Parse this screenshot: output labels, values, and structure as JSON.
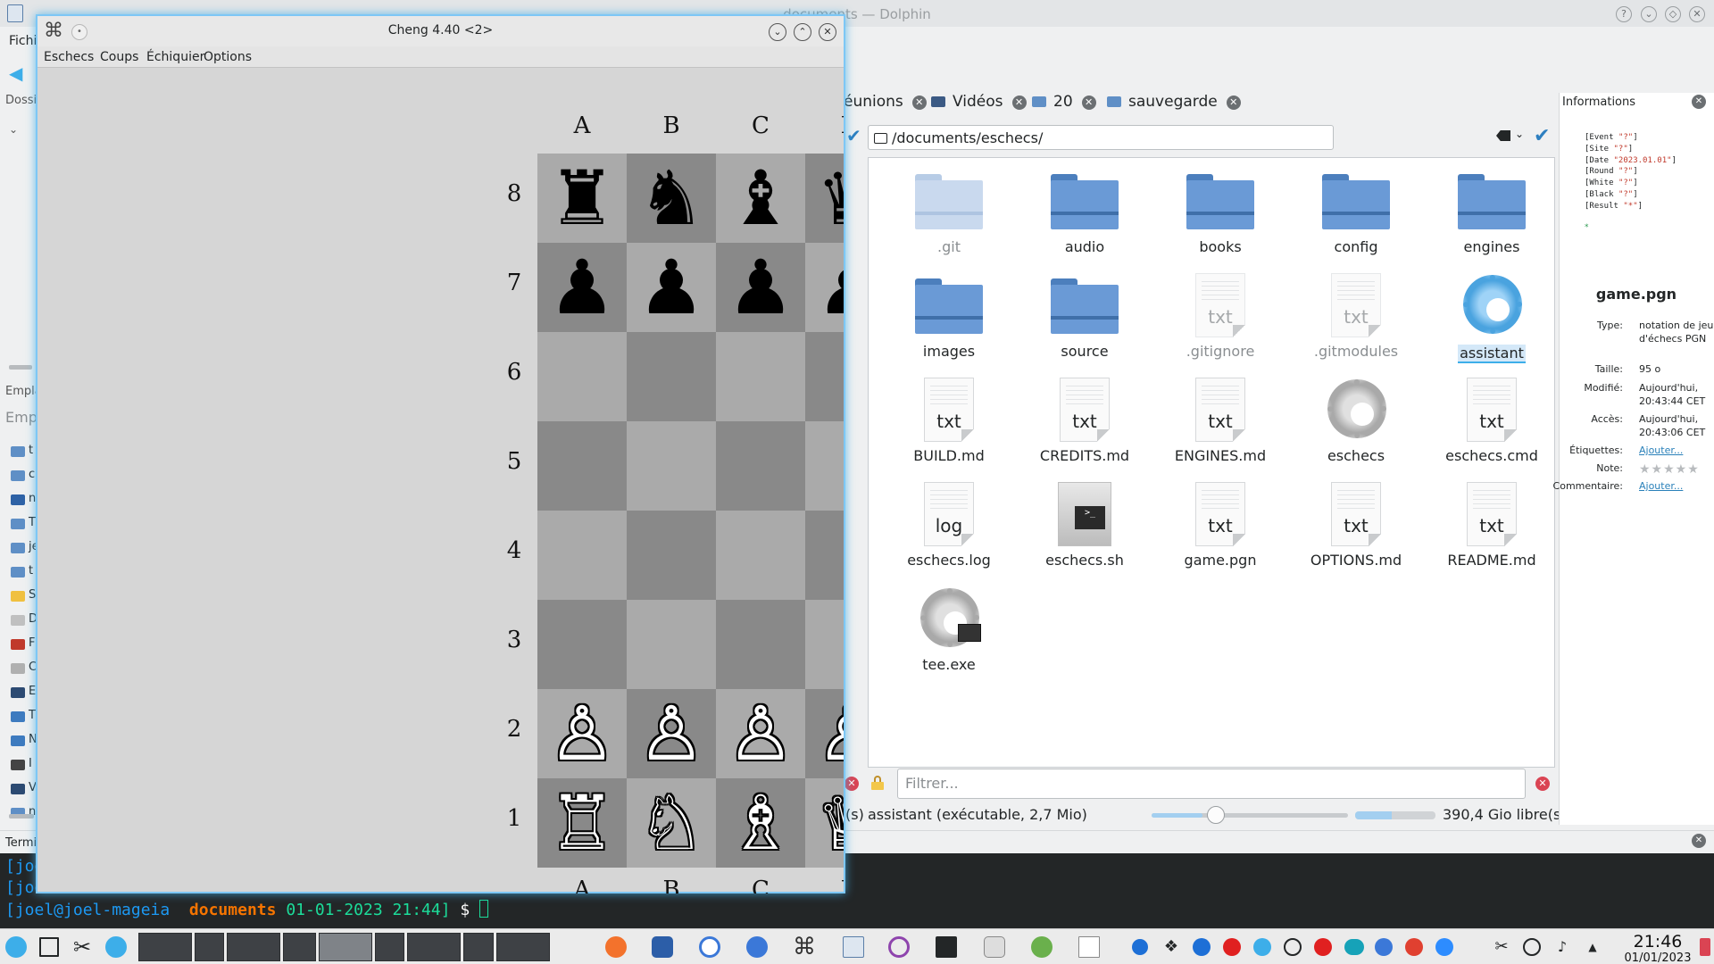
{
  "dolphin": {
    "title": "documents — Dolphin",
    "menu_partial": "Fichi",
    "sidebar": {
      "dossiers_label": "Dossi",
      "places_label": "Empla",
      "places_search": "Emp",
      "items": [
        {
          "label": "t",
          "color": "#5f8fc6"
        },
        {
          "label": "c",
          "color": "#5f8fc6"
        },
        {
          "label": "n",
          "color": "#2e62a6"
        },
        {
          "label": "T",
          "color": "#5f8fc6"
        },
        {
          "label": "je",
          "color": "#5f8fc6"
        },
        {
          "label": "t",
          "color": "#5f8fc6"
        },
        {
          "label": "S",
          "color": "#f0c040"
        },
        {
          "label": "D",
          "color": "#c0c0c0"
        },
        {
          "label": "F",
          "color": "#c0392b"
        },
        {
          "label": "C",
          "color": "#b0b0b0"
        },
        {
          "label": "E",
          "color": "#2c4a72"
        },
        {
          "label": "T",
          "color": "#3e7bbf"
        },
        {
          "label": "N",
          "color": "#3e7bbf"
        },
        {
          "label": "I",
          "color": "#444"
        },
        {
          "label": "V",
          "color": "#2c4a72"
        },
        {
          "label": "n",
          "color": "#5f8fc6"
        }
      ]
    },
    "tabs": [
      {
        "label": "éunions"
      },
      {
        "label": "Vidéos"
      },
      {
        "label": "20"
      },
      {
        "label": "sauvegarde"
      }
    ],
    "location": "/documents/eschecs/",
    "files": [
      {
        "name": ".git",
        "kind": "folder-dim"
      },
      {
        "name": "audio",
        "kind": "folder"
      },
      {
        "name": "books",
        "kind": "folder"
      },
      {
        "name": "config",
        "kind": "folder"
      },
      {
        "name": "engines",
        "kind": "folder"
      },
      {
        "name": "images",
        "kind": "folder"
      },
      {
        "name": "source",
        "kind": "folder"
      },
      {
        "name": ".gitignore",
        "kind": "text-dim",
        "ext": "txt"
      },
      {
        "name": ".gitmodules",
        "kind": "text-dim",
        "ext": "txt"
      },
      {
        "name": "assistant",
        "kind": "gear-blue"
      },
      {
        "name": "BUILD.md",
        "kind": "text",
        "ext": "txt"
      },
      {
        "name": "CREDITS.md",
        "kind": "text",
        "ext": "txt"
      },
      {
        "name": "ENGINES.md",
        "kind": "text",
        "ext": "txt"
      },
      {
        "name": "eschecs",
        "kind": "gear-grey"
      },
      {
        "name": "eschecs.cmd",
        "kind": "text",
        "ext": "txt"
      },
      {
        "name": "eschecs.log",
        "kind": "text",
        "ext": "log"
      },
      {
        "name": "eschecs.sh",
        "kind": "terminal"
      },
      {
        "name": "game.pgn",
        "kind": "text",
        "ext": "txt"
      },
      {
        "name": "OPTIONS.md",
        "kind": "text",
        "ext": "txt"
      },
      {
        "name": "README.md",
        "kind": "text",
        "ext": "txt"
      },
      {
        "name": "tee.exe",
        "kind": "gear-dos"
      }
    ],
    "filter_placeholder": "Filtrer...",
    "status_left": "(s)",
    "status_text": "assistant (exécutable, 2,7 Mio)",
    "zoom_fraction": 0.26,
    "space_used_fraction": 0.45,
    "free_space": "390,4 Gio libre(s)",
    "info": {
      "title": "Informations",
      "pgn_lines": [
        {
          "key": "[Event ",
          "val": "\"?\"",
          "end": "]"
        },
        {
          "key": "[Site ",
          "val": "\"?\"",
          "end": "]"
        },
        {
          "key": "[Date ",
          "val": "\"2023.01.01\"",
          "end": "]"
        },
        {
          "key": "[Round ",
          "val": "\"?\"",
          "end": "]"
        },
        {
          "key": "[White ",
          "val": "\"?\"",
          "end": "]"
        },
        {
          "key": "[Black ",
          "val": "\"?\"",
          "end": "]"
        },
        {
          "key": "[Result ",
          "val": "\"*\"",
          "end": "]"
        }
      ],
      "pgn_star": "*",
      "filename": "game.pgn",
      "rows": [
        {
          "key": "Type:",
          "value": "notation de jeu d'échecs PGN",
          "link": false
        },
        {
          "key": "Taille:",
          "value": "95 o",
          "link": false
        },
        {
          "key": "Modifié:",
          "value": "Aujourd'hui, 20:43:44 CET",
          "link": false
        },
        {
          "key": "Accès:",
          "value": "Aujourd'hui, 20:43:06 CET",
          "link": false
        },
        {
          "key": "Étiquettes:",
          "value": "Ajouter...",
          "link": true
        },
        {
          "key": "Note:",
          "value": "",
          "link": false
        },
        {
          "key": "Commentaire:",
          "value": "Ajouter...",
          "link": true
        }
      ],
      "stars": "★★★★★"
    },
    "terminal": {
      "header": "Termi",
      "lines": [
        {
          "user": "[joe",
          "dir": "",
          "date": "",
          "rest": ""
        },
        {
          "user": "[joe",
          "dir": "",
          "date": "",
          "rest": ""
        },
        {
          "user": "[joel@joel-mageia",
          "dir": "documents",
          "date": "01-01-2023 21:44]",
          "rest": " $ "
        }
      ]
    }
  },
  "cheng": {
    "title": "Cheng 4.40 <2>",
    "app_icon": "⌘",
    "menu": [
      "Eschecs",
      "Coups",
      "Échiquier",
      "Options"
    ],
    "files_top": [
      "A",
      "B",
      "C",
      "D"
    ],
    "files_bottom": [
      "A",
      "B",
      "C",
      "D"
    ],
    "ranks": [
      "8",
      "7",
      "6",
      "5",
      "4",
      "3",
      "2",
      "1"
    ],
    "board": [
      [
        "♜",
        "♞",
        "♝",
        "♛"
      ],
      [
        "♟",
        "♟",
        "♟",
        "♟"
      ],
      [
        "",
        "",
        "",
        ""
      ],
      [
        "",
        "",
        "",
        ""
      ],
      [
        "",
        "",
        "",
        ""
      ],
      [
        "",
        "",
        "",
        ""
      ],
      [
        "♙",
        "♙",
        "♙",
        "♙"
      ],
      [
        "♖",
        "♘",
        "♗",
        "♕"
      ]
    ]
  },
  "taskbar": {
    "time": "21:46",
    "date": "01/01/2023"
  }
}
